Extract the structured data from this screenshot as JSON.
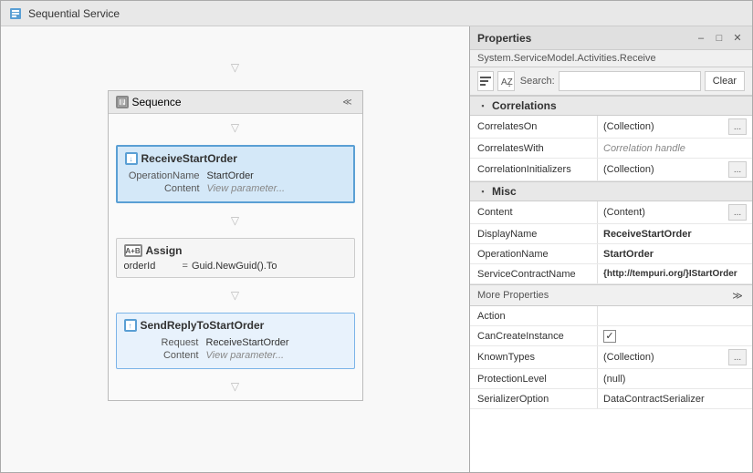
{
  "titleBar": {
    "text": "Sequential Service",
    "iconLabel": "sequential-service-icon"
  },
  "workflow": {
    "sequenceLabel": "Sequence",
    "receiveBlock": {
      "name": "ReceiveStartOrder",
      "operationNameLabel": "OperationName",
      "operationNameValue": "StartOrder",
      "contentLabel": "Content",
      "contentPlaceholder": "View parameter..."
    },
    "assignBlock": {
      "name": "Assign",
      "variable": "orderId",
      "equals": "=",
      "value": "Guid.NewGuid().To"
    },
    "sendReplyBlock": {
      "name": "SendReplyToStartOrder",
      "requestLabel": "Request",
      "requestValue": "ReceiveStartOrder",
      "contentLabel": "Content",
      "contentPlaceholder": "View parameter..."
    }
  },
  "properties": {
    "title": "Properties",
    "subtitle": "System.ServiceModel.Activities.Receive",
    "searchPlaceholder": "Search:",
    "clearLabel": "Clear",
    "sections": {
      "correlations": {
        "label": "Correlations",
        "rows": [
          {
            "name": "CorrelatesOn",
            "value": "(Collection)",
            "hasBtn": true,
            "italic": false
          },
          {
            "name": "CorrelatesWith",
            "value": "Correlation handle",
            "hasBtn": false,
            "italic": true
          },
          {
            "name": "CorrelationInitializers",
            "value": "(Collection)",
            "hasBtn": true,
            "italic": false
          }
        ]
      },
      "misc": {
        "label": "Misc",
        "rows": [
          {
            "name": "Content",
            "value": "(Content)",
            "hasBtn": true,
            "italic": false
          },
          {
            "name": "DisplayName",
            "value": "ReceiveStartOrder",
            "hasBtn": false,
            "italic": false,
            "bold": true
          },
          {
            "name": "OperationName",
            "value": "StartOrder",
            "hasBtn": false,
            "italic": false,
            "bold": true
          },
          {
            "name": "ServiceContractName",
            "value": "{http://tempuri.org/}IStartOrder",
            "hasBtn": false,
            "italic": false,
            "bold": true
          }
        ]
      },
      "moreProperties": {
        "label": "More Properties",
        "rows": [
          {
            "name": "Action",
            "value": "",
            "hasBtn": false,
            "italic": false
          },
          {
            "name": "CanCreateInstance",
            "value": "checkbox",
            "hasBtn": false,
            "italic": false
          },
          {
            "name": "KnownTypes",
            "value": "(Collection)",
            "hasBtn": true,
            "italic": false
          },
          {
            "name": "ProtectionLevel",
            "value": "(null)",
            "hasBtn": false,
            "italic": false
          },
          {
            "name": "SerializerOption",
            "value": "DataContractSerializer",
            "hasBtn": false,
            "italic": false
          }
        ]
      }
    },
    "controls": {
      "pin": "📌",
      "minimize": "─",
      "close": "✕"
    }
  }
}
